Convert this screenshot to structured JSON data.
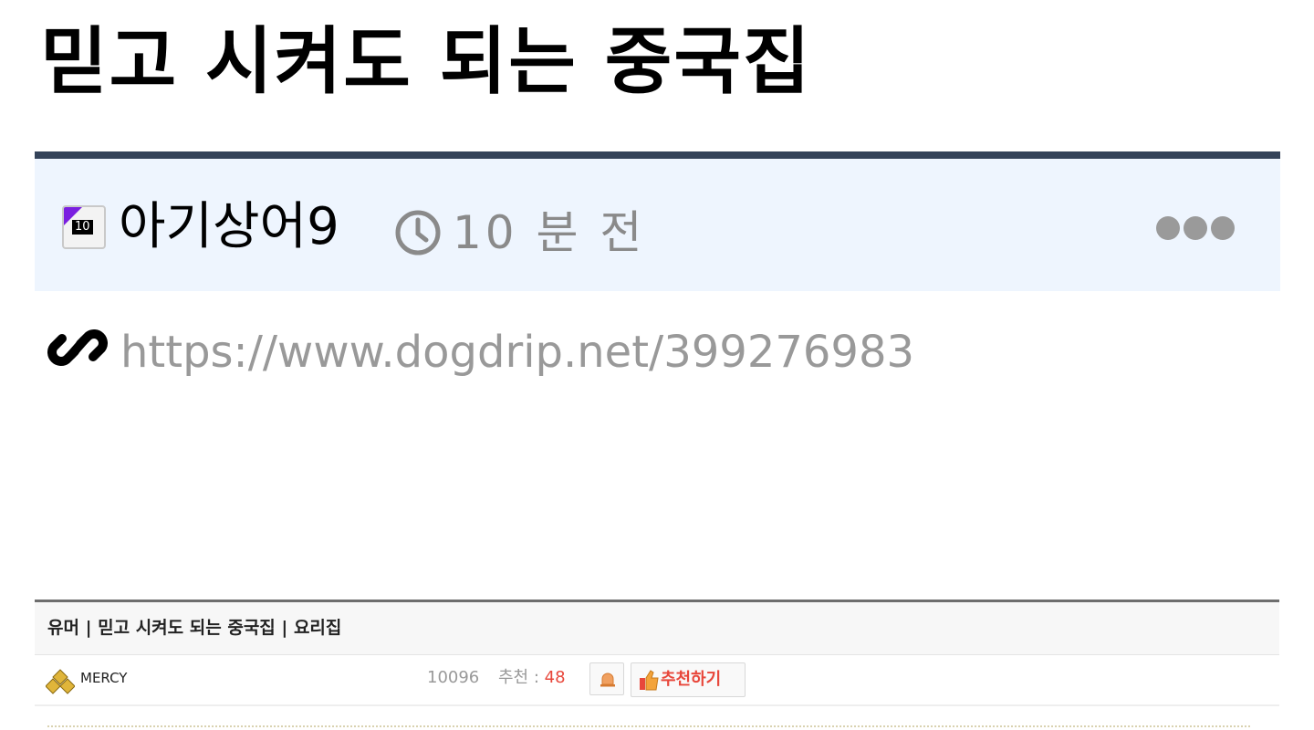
{
  "post": {
    "title": "믿고 시켜도 되는 중국집",
    "author": "아기상어9",
    "author_level": "10",
    "time_ago": "10 분 전",
    "link_url": "https://www.dogdrip.net/399276983"
  },
  "embed": {
    "title": "유머 | 믿고 시켜도 되는 중국집 | 요리집",
    "author": "MERCY",
    "views": "10096",
    "recommend_label": "추천 : ",
    "recommend_count": "48",
    "recommend_button_label": "추천하기"
  },
  "icons": {
    "clock": "clock-icon",
    "more": "more-dots-icon",
    "link": "link-icon",
    "level": "level-icon",
    "bell": "bell-icon",
    "thumbs_up": "thumbs-up-icon"
  },
  "colors": {
    "header_border": "#344359",
    "header_bg": "#eef5fe",
    "muted_text": "#999999",
    "accent_red": "#e8473b"
  }
}
